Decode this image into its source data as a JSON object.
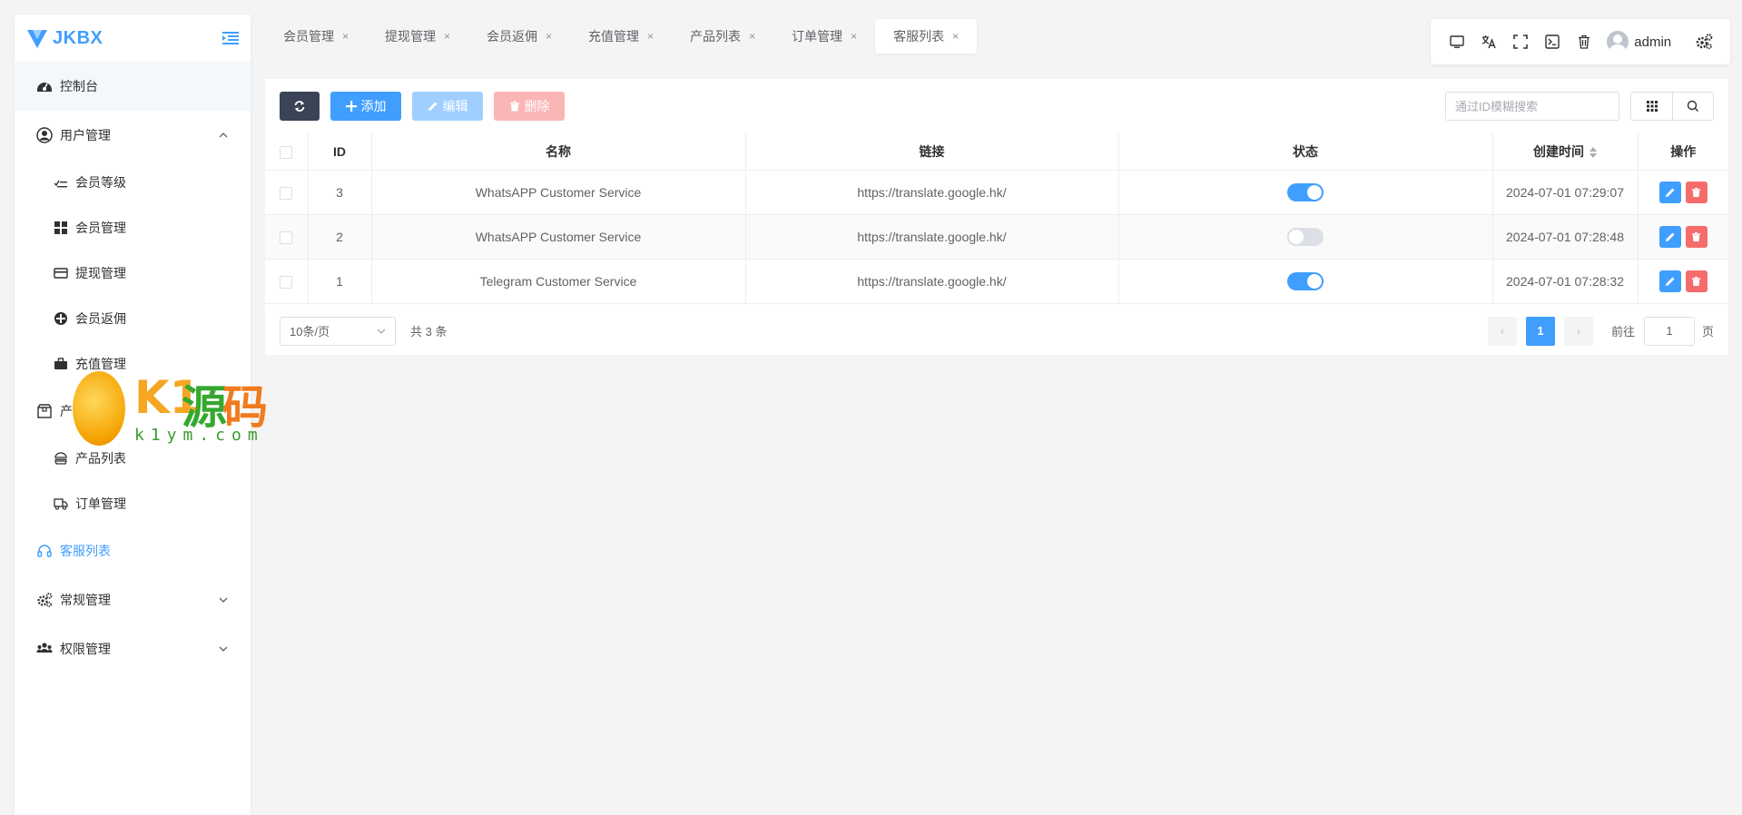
{
  "app": {
    "brand": "JKBX"
  },
  "sidebar": {
    "items": [
      {
        "label": "控制台",
        "icon": "dashboard-icon"
      },
      {
        "label": "用户管理",
        "icon": "user-circle-icon",
        "expanded": true
      },
      {
        "label": "会员等级",
        "icon": "list-check-icon"
      },
      {
        "label": "会员管理",
        "icon": "grid-icon"
      },
      {
        "label": "提现管理",
        "icon": "card-icon"
      },
      {
        "label": "会员返佣",
        "icon": "circle-plus-icon"
      },
      {
        "label": "充值管理",
        "icon": "briefcase-icon"
      },
      {
        "label": "产品管理",
        "icon": "box-icon"
      },
      {
        "label": "产品列表",
        "icon": "burger-icon"
      },
      {
        "label": "订单管理",
        "icon": "truck-icon"
      },
      {
        "label": "客服列表",
        "icon": "headset-icon",
        "active": true
      },
      {
        "label": "常规管理",
        "icon": "gears-icon"
      },
      {
        "label": "权限管理",
        "icon": "users-icon"
      }
    ]
  },
  "watermark": {
    "k": "K1",
    "yuan": "源",
    "ma": "码",
    "domain": "k1ym.com"
  },
  "tabs": [
    {
      "label": "会员管理"
    },
    {
      "label": "提现管理"
    },
    {
      "label": "会员返佣"
    },
    {
      "label": "充值管理"
    },
    {
      "label": "产品列表"
    },
    {
      "label": "订单管理"
    },
    {
      "label": "客服列表",
      "active": true
    }
  ],
  "tab_close": "×",
  "topbar": {
    "username": "admin"
  },
  "toolbar": {
    "add_label": "添加",
    "edit_label": "编辑",
    "delete_label": "删除",
    "search_placeholder": "通过ID模糊搜索"
  },
  "table": {
    "columns": [
      "ID",
      "名称",
      "链接",
      "状态",
      "创建时间",
      "操作"
    ],
    "rows": [
      {
        "id": "3",
        "name": "WhatsAPP Customer Service",
        "link": "https://translate.google.hk/",
        "status": true,
        "created": "2024-07-01 07:29:07"
      },
      {
        "id": "2",
        "name": "WhatsAPP Customer Service",
        "link": "https://translate.google.hk/",
        "status": false,
        "created": "2024-07-01 07:28:48"
      },
      {
        "id": "1",
        "name": "Telegram Customer Service",
        "link": "https://translate.google.hk/",
        "status": true,
        "created": "2024-07-01 07:28:32"
      }
    ]
  },
  "pagination": {
    "page_size": "10条/页",
    "total": "共 3 条",
    "current_page": "1",
    "goto_label": "前往",
    "goto_value": "1",
    "page_suffix": "页",
    "prev": "‹",
    "next": "›"
  },
  "colors": {
    "primary": "#409eff",
    "danger": "#f56c6c",
    "dark": "#3b4457"
  }
}
